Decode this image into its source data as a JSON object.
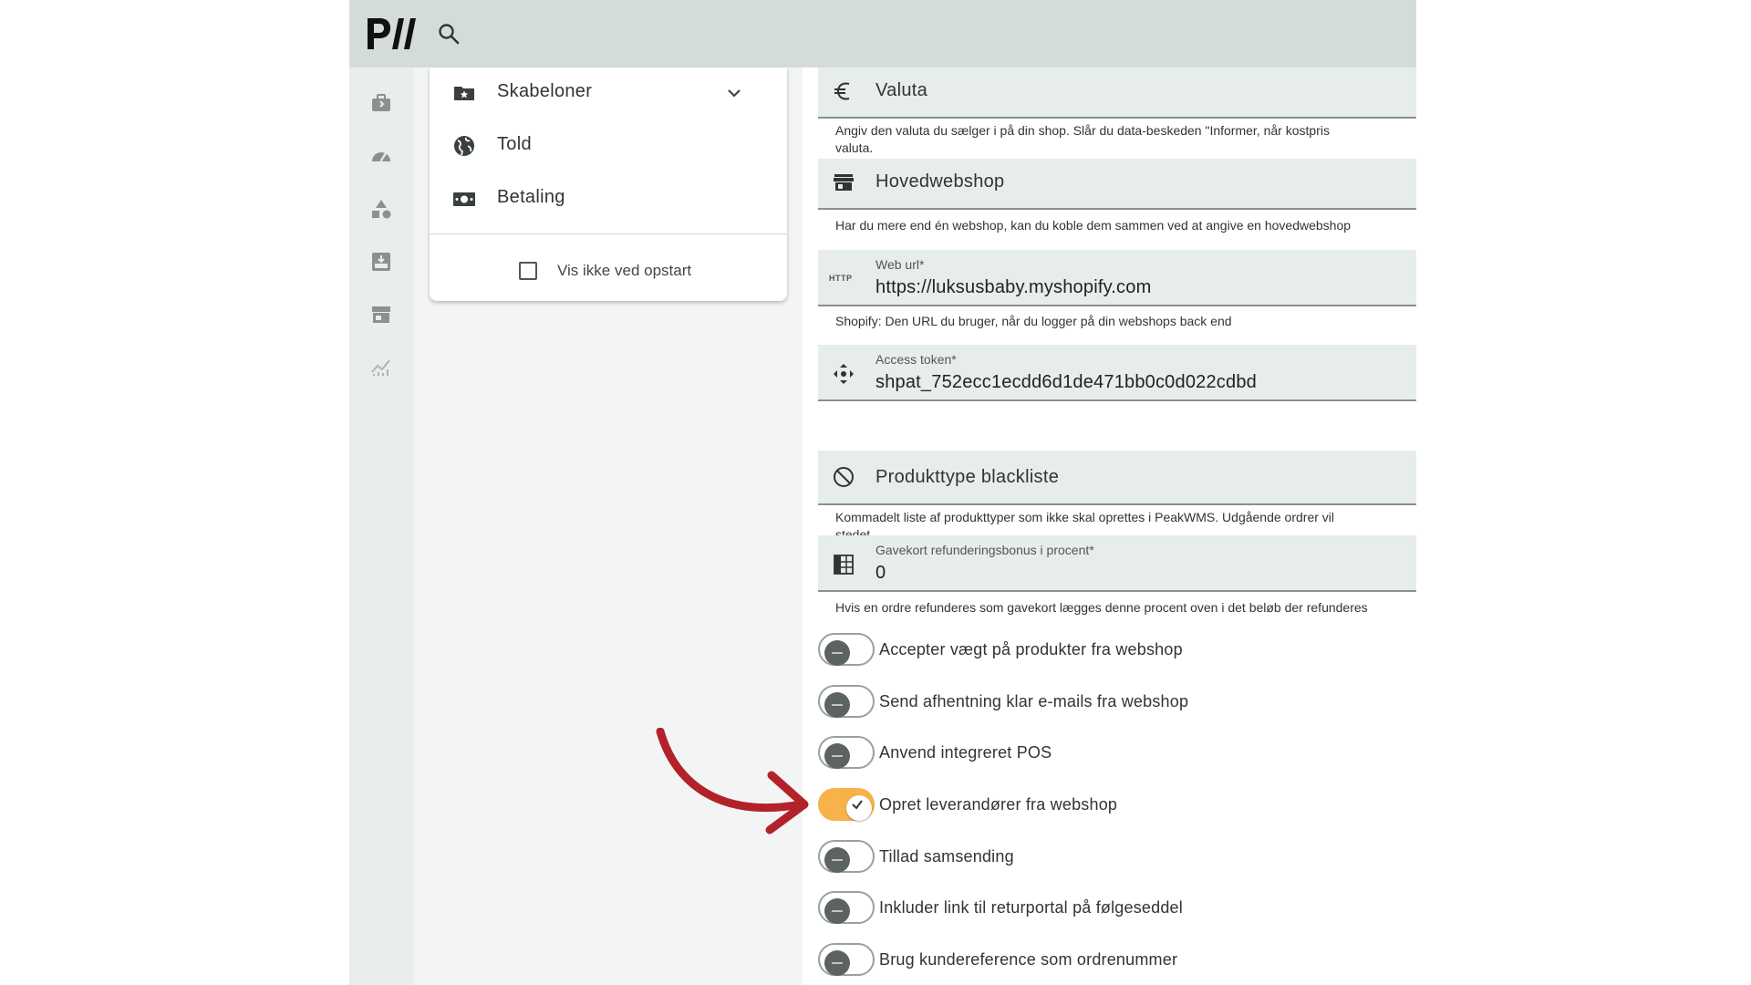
{
  "app": {
    "accent_color": "#f7b24a",
    "annotation_color": "#b3222a"
  },
  "topbar": {
    "logo_icon": "peakwms-logo-icon",
    "search_icon": "search-icon"
  },
  "rail": {
    "items": [
      {
        "icon": "briefcase-icon"
      },
      {
        "icon": "speedometer-icon"
      },
      {
        "icon": "shapes-icon"
      },
      {
        "icon": "inbox-download-icon"
      },
      {
        "icon": "store-icon"
      },
      {
        "icon": "chart-icon"
      }
    ]
  },
  "menu": {
    "items": [
      {
        "label": "Skabeloner",
        "icon": "folder-star-icon",
        "has_chevron": true
      },
      {
        "label": "Told",
        "icon": "globe-icon"
      },
      {
        "label": "Betaling",
        "icon": "cash-icon"
      }
    ],
    "checkbox_label": "Vis ikke ved opstart",
    "checkbox_checked": false
  },
  "settings": {
    "currency": {
      "title": "Valuta",
      "icon": "euro-icon",
      "helper_line1": "Angiv den valuta du sælger i på din shop. Slår du data-beskeden \"Informer, når kostpris",
      "helper_line2": "valuta."
    },
    "main_webshop": {
      "title": "Hovedwebshop",
      "icon": "storefront-icon",
      "helper": "Har du mere end én webshop, kan du koble dem sammen ved at angive en hovedwebshop"
    },
    "web_url": {
      "label": "Web url*",
      "value": "https://luksusbaby.myshopify.com",
      "icon_text": "HTTP",
      "helper": "Shopify: Den URL du bruger, når du logger på din webshops back end"
    },
    "access_token": {
      "label": "Access token*",
      "value": "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",
      "icon": "move-arrows-icon"
    },
    "blacklist": {
      "title": "Produkttype blackliste",
      "icon": "block-icon",
      "helper_line1": "Kommadelt liste af produkttyper som ikke skal oprettes i PeakWMS. Udgående ordrer vil",
      "helper_line2": "stedet"
    },
    "giftcard_bonus": {
      "label": "Gavekort refunderingsbonus i procent*",
      "value": "0",
      "icon": "calculator-grid-icon",
      "helper": "Hvis en ordre refunderes som gavekort lægges denne procent oven i det beløb der refunderes"
    },
    "toggles": [
      {
        "label": "Accepter vægt på produkter fra webshop",
        "on": false
      },
      {
        "label": "Send afhentning klar e-mails fra webshop",
        "on": false
      },
      {
        "label": "Anvend integreret POS",
        "on": false
      },
      {
        "label": "Opret leverandører fra webshop",
        "on": true
      },
      {
        "label": "Tillad samsending",
        "on": false
      },
      {
        "label": "Inkluder link til returportal på følgeseddel",
        "on": false
      },
      {
        "label": "Brug kundereference som ordrenummer",
        "on": false
      }
    ]
  },
  "annotation": {
    "icon": "curved-arrow-icon"
  }
}
